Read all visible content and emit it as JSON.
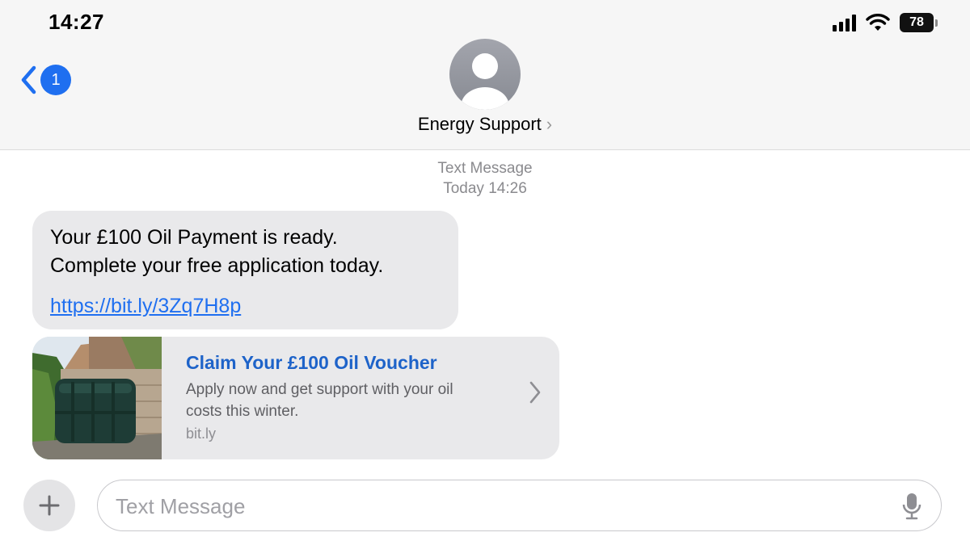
{
  "status_bar": {
    "time": "14:27",
    "battery": "78",
    "icons": [
      "cellular-signal-icon",
      "wifi-icon",
      "battery-icon"
    ]
  },
  "header": {
    "back_badge": "1",
    "contact_name": "Energy Support",
    "icons": [
      "back-chevron-icon",
      "contact-avatar-icon",
      "chevron-right-icon"
    ]
  },
  "conversation": {
    "meta_type": "Text Message",
    "meta_time": "Today 14:26",
    "messages": [
      {
        "line1": "Your £100 Oil Payment is ready.",
        "line2": "Complete your free application today.",
        "link": "https://bit.ly/3Zq7H8p"
      }
    ],
    "preview": {
      "title": "Claim Your £100 Oil Voucher",
      "description": "Apply now and get support with your oil costs this winter.",
      "domain": "bit.ly",
      "image": "oil-tank-photo"
    }
  },
  "composer": {
    "placeholder": "Text Message",
    "value": "",
    "icons": [
      "plus-icon",
      "microphone-icon"
    ]
  },
  "colors": {
    "accent": "#1f6ff0",
    "link_title": "#1e63c9",
    "bubble": "#e9e9eb",
    "header_bg": "#f6f6f6"
  }
}
